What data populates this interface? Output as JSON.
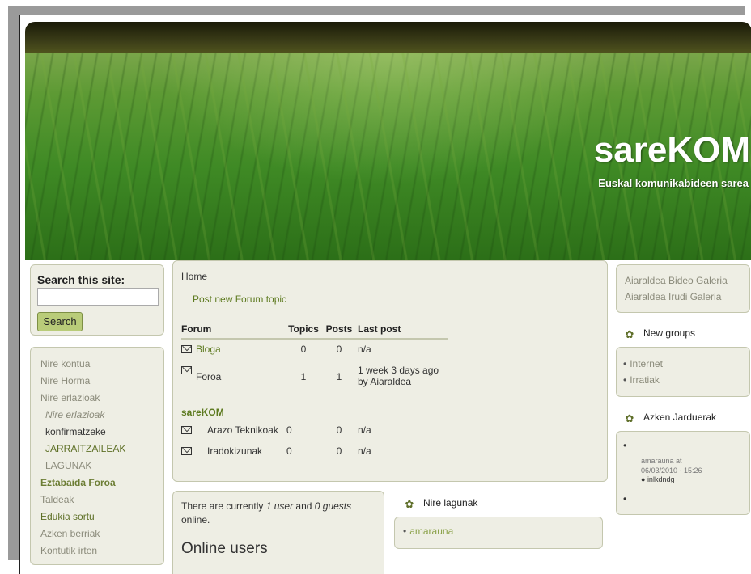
{
  "header": {
    "site_name": "sareKOM",
    "slogan": "Euskal komunikabideen sarea"
  },
  "search": {
    "title": "Search this site:",
    "input_value": "",
    "button_label": "Search"
  },
  "nav": {
    "items": [
      {
        "label": "Nire kontua"
      },
      {
        "label": "Nire Horma"
      },
      {
        "label": "Nire erlazioak"
      },
      {
        "label": "Nire erlazioak"
      },
      {
        "label": "konfirmatzeke"
      },
      {
        "label": "JARRAITZAILEAK"
      },
      {
        "label": "LAGUNAK"
      },
      {
        "label": "Eztabaida Foroa"
      },
      {
        "label": "Taldeak"
      },
      {
        "label": "Edukia sortu"
      },
      {
        "label": "Azken berriak"
      },
      {
        "label": "Kontutik irten"
      }
    ]
  },
  "forum": {
    "breadcrumb": "Home",
    "new_topic_link": "Post new Forum topic",
    "columns": [
      "Forum",
      "Topics",
      "Posts",
      "Last post"
    ],
    "rows": [
      {
        "name": "Bloga",
        "topics": "0",
        "posts": "0",
        "last": "n/a",
        "last2": ""
      },
      {
        "name": "Foroa",
        "topics": "1",
        "posts": "1",
        "last": "1 week 3 days ago",
        "last2": "by Aiaraldea"
      }
    ],
    "group_title": "sareKOM",
    "group_rows": [
      {
        "name": "Arazo Teknikoak",
        "topics": "0",
        "posts": "0",
        "last": "n/a"
      },
      {
        "name": "Iradokizunak",
        "topics": "0",
        "posts": "0",
        "last": "n/a"
      }
    ]
  },
  "online": {
    "prefix": "There are currently ",
    "users": "1 user",
    "mid": " and ",
    "guests": "0 guests",
    "suffix": " online.",
    "title": "Online users"
  },
  "friends": {
    "title": "Nire lagunak",
    "items": [
      "amarauna"
    ]
  },
  "gallery": {
    "links": [
      "Aiaraldea Bideo Galeria",
      "Aiaraldea Irudi Galeria"
    ]
  },
  "groups": {
    "title": "New groups",
    "items": [
      "Internet",
      "Irratiak"
    ]
  },
  "activity": {
    "title": "Azken Jarduerak",
    "line1": "amarauna at",
    "line2": "06/03/2010 - 15:26",
    "sub_item": "inlkdndg"
  }
}
